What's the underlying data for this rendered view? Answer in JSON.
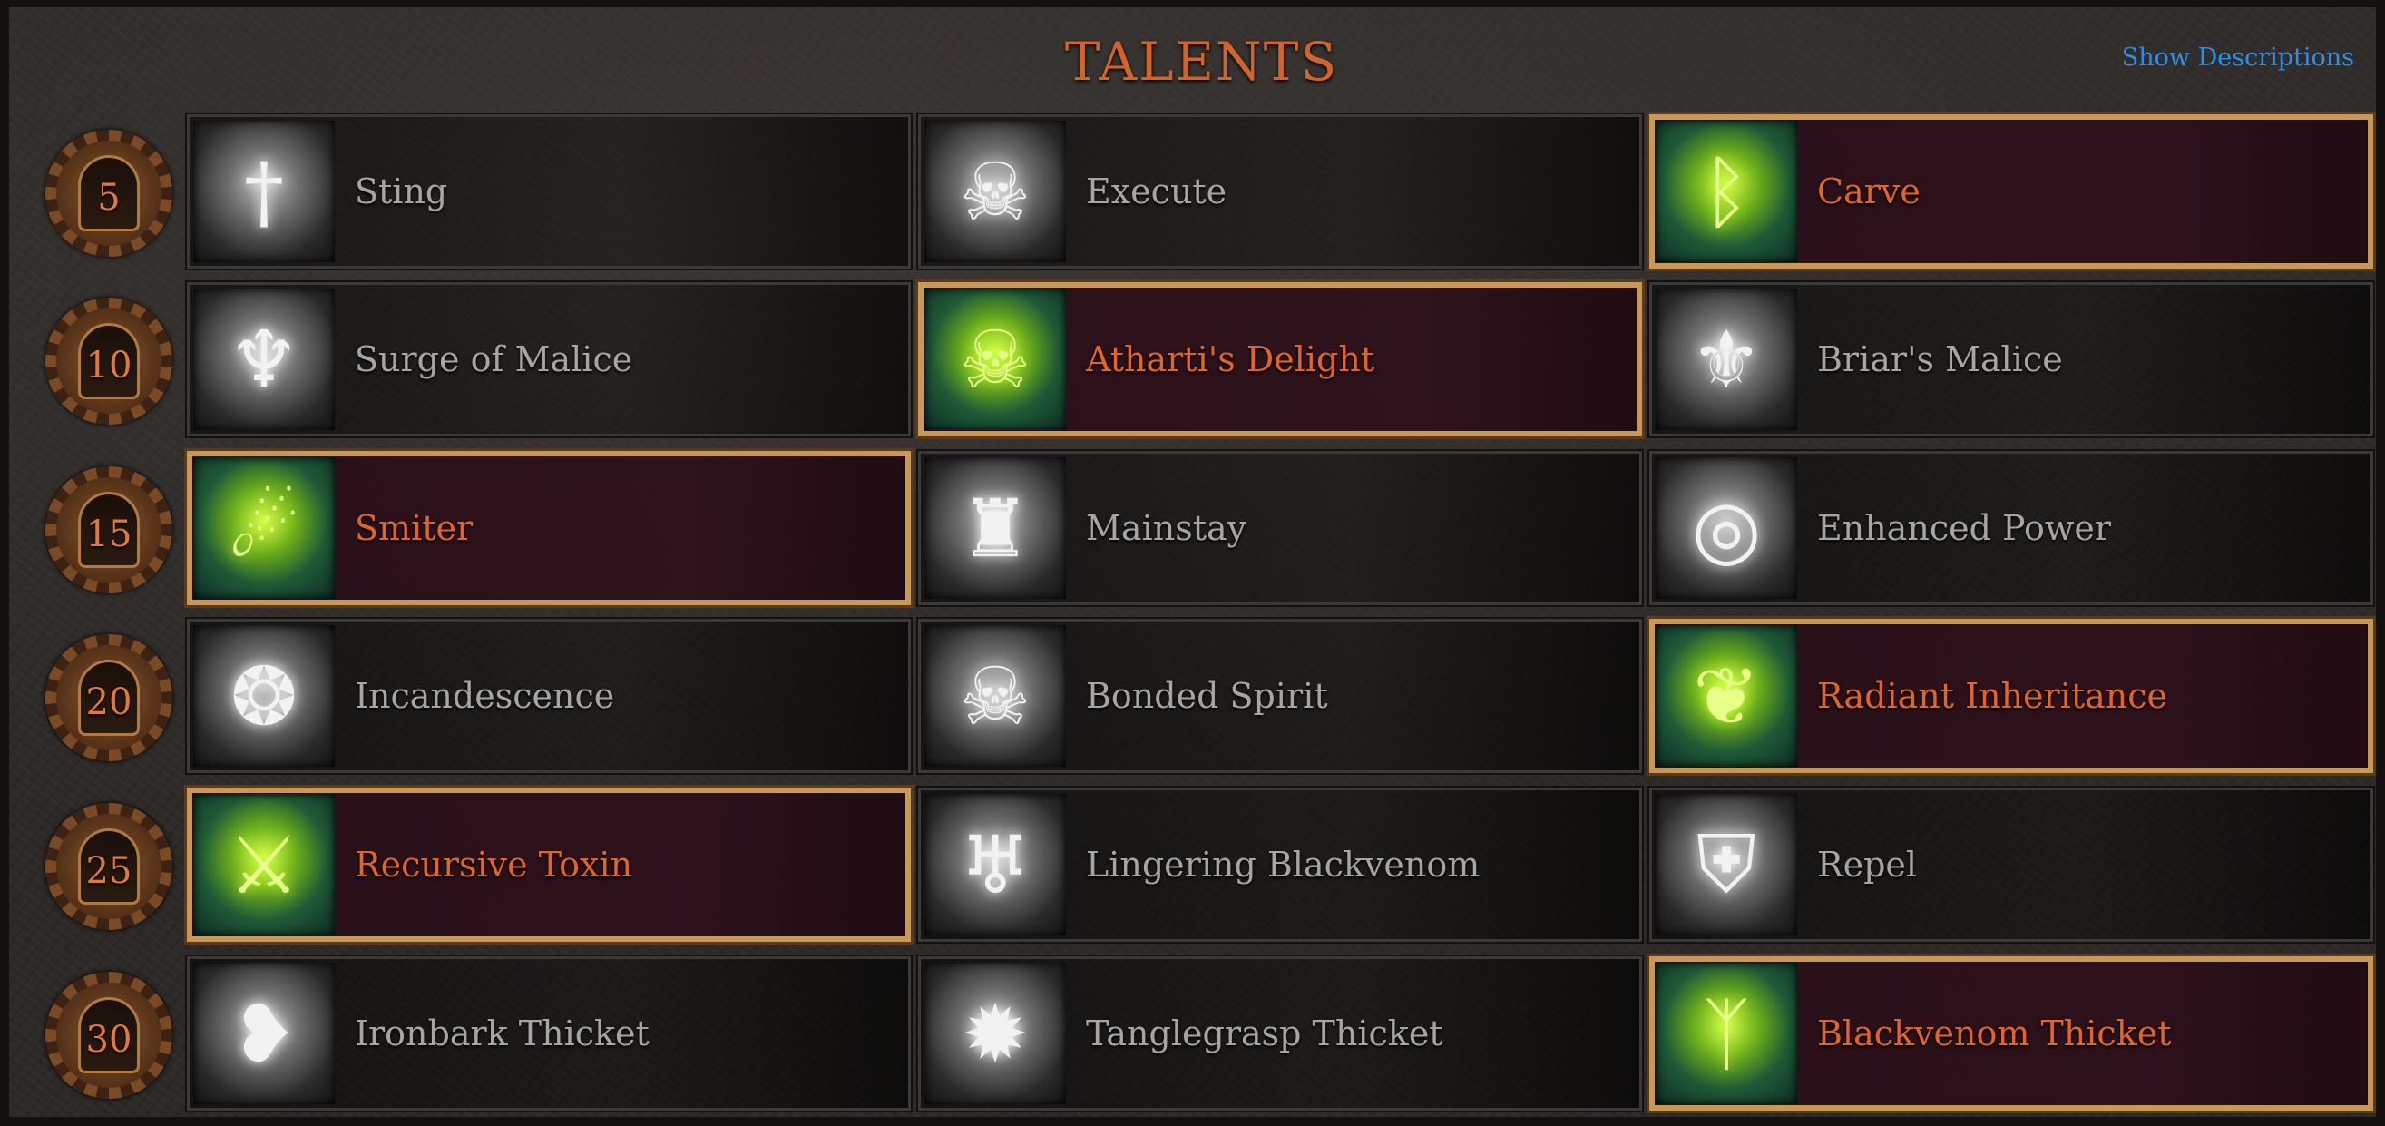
{
  "header": {
    "title": "TALENTS",
    "show_descriptions_label": "Show Descriptions"
  },
  "colors": {
    "title": "#d2642b",
    "selected_label": "#e0652a",
    "unselected_label": "#a8a4a0",
    "link": "#2f8ee8",
    "selected_border": "#c89858"
  },
  "rows": [
    {
      "level": "5",
      "talents": [
        {
          "name": "Sting",
          "icon": "dagger-icon",
          "selected": false
        },
        {
          "name": "Execute",
          "icon": "helmed-skull-icon",
          "selected": false
        },
        {
          "name": "Carve",
          "icon": "rune-icon",
          "selected": true
        }
      ]
    },
    {
      "level": "10",
      "talents": [
        {
          "name": "Surge of Malice",
          "icon": "flame-sigil-icon",
          "selected": false
        },
        {
          "name": "Atharti's Delight",
          "icon": "glowing-skull-icon",
          "selected": true
        },
        {
          "name": "Briar's Malice",
          "icon": "thorn-sigil-icon",
          "selected": false
        }
      ]
    },
    {
      "level": "15",
      "talents": [
        {
          "name": "Smiter",
          "icon": "arc-strike-icon",
          "selected": true
        },
        {
          "name": "Mainstay",
          "icon": "hooded-figure-icon",
          "selected": false
        },
        {
          "name": "Enhanced Power",
          "icon": "swirl-orb-icon",
          "selected": false
        }
      ]
    },
    {
      "level": "20",
      "talents": [
        {
          "name": "Incandescence",
          "icon": "spiral-flame-icon",
          "selected": false
        },
        {
          "name": "Bonded Spirit",
          "icon": "spirit-skull-icon",
          "selected": false
        },
        {
          "name": "Radiant Inheritance",
          "icon": "radiant-tree-icon",
          "selected": true
        }
      ]
    },
    {
      "level": "25",
      "talents": [
        {
          "name": "Recursive Toxin",
          "icon": "toxic-blade-icon",
          "selected": true
        },
        {
          "name": "Lingering Blackvenom",
          "icon": "venom-spirits-icon",
          "selected": false
        },
        {
          "name": "Repel",
          "icon": "shield-rune-icon",
          "selected": false
        }
      ]
    },
    {
      "level": "30",
      "talents": [
        {
          "name": "Ironbark Thicket",
          "icon": "thorned-heart-icon",
          "selected": false
        },
        {
          "name": "Tanglegrasp Thicket",
          "icon": "thorn-ring-icon",
          "selected": false
        },
        {
          "name": "Blackvenom Thicket",
          "icon": "venom-glyph-icon",
          "selected": true
        }
      ]
    }
  ]
}
